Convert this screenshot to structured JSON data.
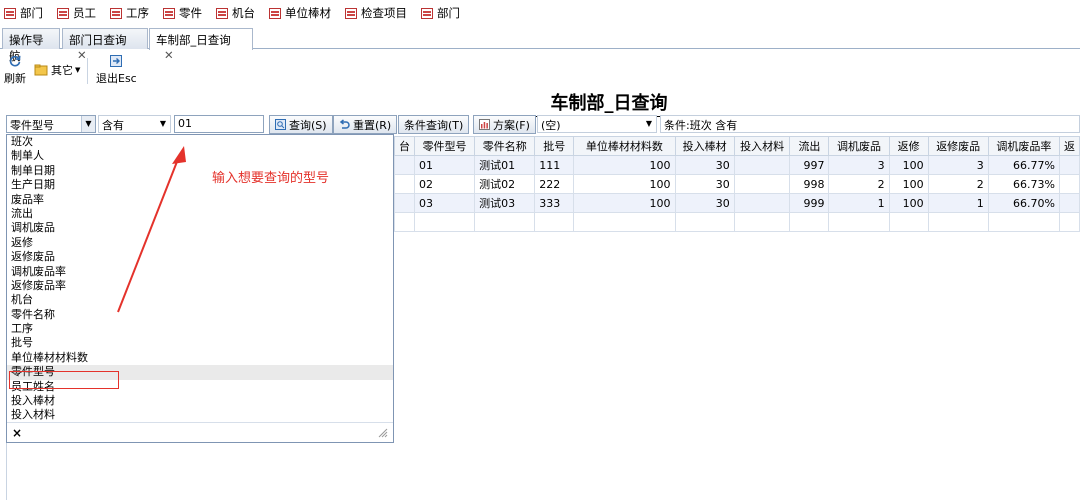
{
  "menubar": {
    "items": [
      "部门",
      "员工",
      "工序",
      "零件",
      "机台",
      "单位棒材",
      "检查项目",
      "部门"
    ]
  },
  "tabs": [
    {
      "label": "操作导航",
      "closable": false
    },
    {
      "label": "部门日查询",
      "closable": true
    },
    {
      "label": "车制部_日查询",
      "closable": true,
      "active": true
    }
  ],
  "toolbar": {
    "refresh": "刷新",
    "other": "其它",
    "exit": "退出Esc"
  },
  "page_title": "车制部_日查询",
  "filter": {
    "field": "零件型号",
    "operator": "含有",
    "value": "01",
    "query_btn": "查询(S)",
    "reset_btn": "重置(R)",
    "condition_btn": "条件查询(T)",
    "scheme_btn": "方案(F)",
    "scheme_value": "(空)",
    "condition_text": "条件:班次 含有"
  },
  "dropdown": {
    "items": [
      "班次",
      "制单人",
      "制单日期",
      "生产日期",
      "废品率",
      "流出",
      "调机废品",
      "返修",
      "返修废品",
      "调机废品率",
      "返修废品率",
      "机台",
      "零件名称",
      "工序",
      "批号",
      "单位棒材材料数",
      "零件型号",
      "员工姓名",
      "投入棒材",
      "投入材料"
    ],
    "selected": "零件型号",
    "close": "×"
  },
  "annotation": "输入想要查询的型号",
  "grid": {
    "columns": [
      "台",
      "零件型号",
      "零件名称",
      "批号",
      "单位棒材材料数",
      "投入棒材",
      "投入材料",
      "流出",
      "调机废品",
      "返修",
      "返修废品",
      "调机废品率",
      "返"
    ],
    "rows": [
      [
        "",
        "01",
        "测试01",
        "111",
        "100",
        "30",
        "",
        "997",
        "3",
        "100",
        "3",
        "66.77%",
        ""
      ],
      [
        "",
        "02",
        "测试02",
        "222",
        "100",
        "30",
        "",
        "998",
        "2",
        "100",
        "2",
        "66.73%",
        ""
      ],
      [
        "",
        "03",
        "测试03",
        "333",
        "100",
        "30",
        "",
        "999",
        "1",
        "100",
        "1",
        "66.70%",
        ""
      ]
    ]
  },
  "colors": {
    "accent_red": "#e4322b",
    "border_blue": "#8ea3bd"
  }
}
